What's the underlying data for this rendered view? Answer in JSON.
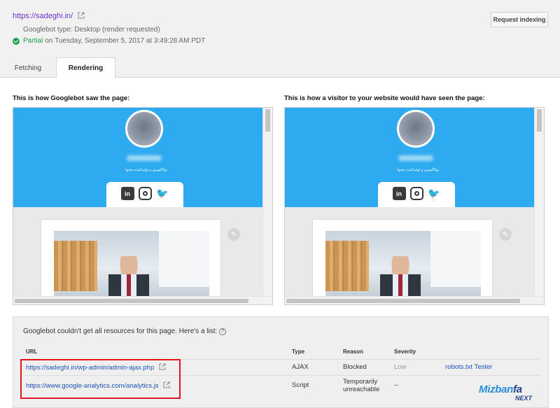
{
  "header": {
    "url": "https://sadeghi.in/",
    "googlebot_type": "Googlebot type: Desktop (render requested)",
    "status_label": "Partial",
    "status_text": "on Tuesday, September 5, 2017 at 3:49:28 AM PDT",
    "request_indexing_label": "Request indexing"
  },
  "tabs": [
    {
      "label": "Fetching",
      "active": false
    },
    {
      "label": "Rendering",
      "active": true
    }
  ],
  "render": {
    "googlebot_caption": "This is how Googlebot saw the page:",
    "visitor_caption": "This is how a visitor to your website would have seen the page:",
    "site_tagline": "وبلاگنویس و تولیدکننده محتوا",
    "social_icons": [
      "linkedin-icon",
      "instagram-icon",
      "twitter-icon"
    ]
  },
  "resources": {
    "heading": "Googlebot couldn't get all resources for this page. Here's a list:",
    "columns": [
      "URL",
      "Type",
      "Reason",
      "Severity"
    ],
    "rows": [
      {
        "url": "https://sadeghi.in/wp-admin/admin-ajax.php",
        "type": "AJAX",
        "reason": "Blocked",
        "severity": "Low",
        "action": "robots.txt Tester"
      },
      {
        "url": "https://www.google-analytics.com/analytics.js",
        "type": "Script",
        "reason_line1": "Temporarily",
        "reason_line2": "unreachable",
        "severity": "--"
      }
    ]
  },
  "watermark": {
    "brand": "Mizbanfa",
    "brand_prefix": "Mizban",
    "brand_suffix": "fa",
    "sub": "NEXT"
  },
  "colors": {
    "link": "#1a53b4",
    "url_purple": "#6633cc",
    "partial_green": "#1e9e50",
    "highlight_red": "#e3141b",
    "site_blue": "#2eabf0"
  }
}
